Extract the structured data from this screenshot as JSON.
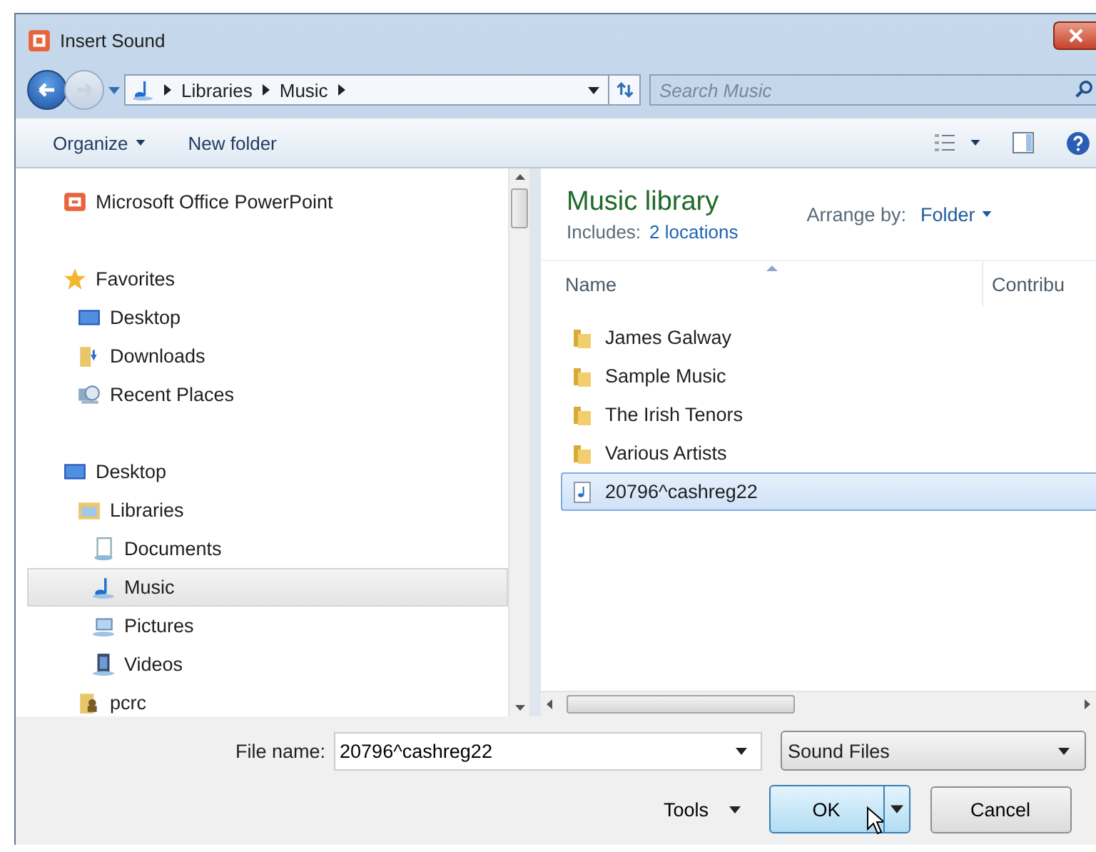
{
  "window": {
    "title": "Insert Sound"
  },
  "address": {
    "crumbs": [
      "Libraries",
      "Music"
    ]
  },
  "search": {
    "placeholder": "Search Music"
  },
  "toolbar": {
    "organize": "Organize",
    "new_folder": "New folder"
  },
  "nav": {
    "items": [
      {
        "label": "Microsoft Office PowerPoint",
        "kind": "app",
        "selected": false
      },
      {
        "label": "Favorites",
        "kind": "star",
        "selected": false,
        "children": [
          {
            "label": "Desktop",
            "kind": "desktop",
            "selected": false
          },
          {
            "label": "Downloads",
            "kind": "downloads",
            "selected": false
          },
          {
            "label": "Recent Places",
            "kind": "recent",
            "selected": false
          }
        ]
      },
      {
        "label": "Desktop",
        "kind": "desktop",
        "selected": false,
        "children": [
          {
            "label": "Libraries",
            "kind": "libraries",
            "selected": false,
            "children": [
              {
                "label": "Documents",
                "kind": "documents",
                "selected": false
              },
              {
                "label": "Music",
                "kind": "music",
                "selected": true
              },
              {
                "label": "Pictures",
                "kind": "pictures",
                "selected": false
              },
              {
                "label": "Videos",
                "kind": "videos",
                "selected": false
              }
            ]
          },
          {
            "label": "pcrc",
            "kind": "user",
            "selected": false
          }
        ]
      }
    ]
  },
  "library": {
    "title": "Music library",
    "includes_label": "Includes:",
    "includes_link": "2 locations",
    "arrange_label": "Arrange by:",
    "arrange_value": "Folder"
  },
  "columns": [
    "Name",
    "Contribu"
  ],
  "files": [
    {
      "name": "James Galway",
      "kind": "folder",
      "selected": false
    },
    {
      "name": "Sample Music",
      "kind": "folder",
      "selected": false
    },
    {
      "name": "The Irish Tenors",
      "kind": "folder",
      "selected": false
    },
    {
      "name": "Various Artists",
      "kind": "folder",
      "selected": false
    },
    {
      "name": "20796^cashreg22",
      "kind": "audio",
      "selected": true
    }
  ],
  "footer": {
    "file_name_label": "File name:",
    "file_name": "20796^cashreg22",
    "filter": "Sound Files",
    "tools": "Tools",
    "ok": "OK",
    "cancel": "Cancel"
  }
}
